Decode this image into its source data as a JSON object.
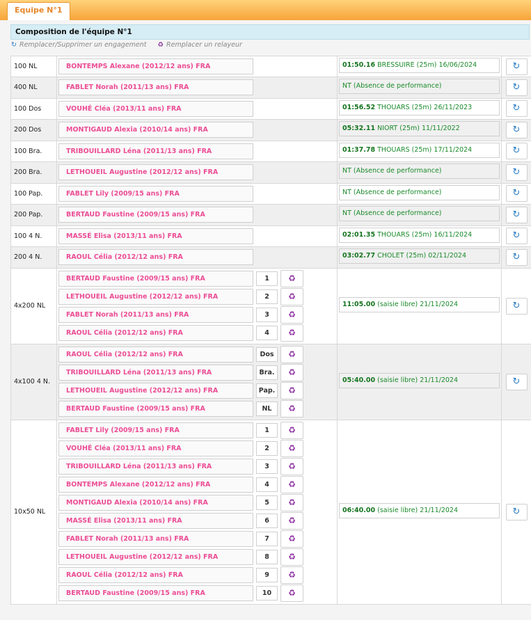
{
  "tab": {
    "label": "Equipe N°1"
  },
  "header": {
    "title": "Composition de l'équipe N°1"
  },
  "legend": {
    "replace_engagement": "Remplacer/Supprimer un engagement",
    "replace_relayer": "Remplacer un relayeur"
  },
  "icons": {
    "update": "refresh-icon",
    "relayer": "recycle-icon"
  },
  "colors": {
    "accent": "#f7a43a",
    "swimmer": "#ec4d95",
    "performance": "#1a8a2a",
    "update_icon": "#2b7cc3",
    "relayer_icon": "#8a2a9e"
  },
  "individual": [
    {
      "event": "100 NL",
      "swimmer": "BONTEMPS Alexane (2012/12 ans) FRA",
      "time": "01:50.16",
      "detail": "BRESSUIRE (25m) 16/06/2024"
    },
    {
      "event": "400 NL",
      "swimmer": "FABLET Norah (2011/13 ans) FRA",
      "time": "",
      "detail": "NT (Absence de performance)"
    },
    {
      "event": "100 Dos",
      "swimmer": "VOUHÉ Cléa (2013/11 ans) FRA",
      "time": "01:56.52",
      "detail": "THOUARS (25m) 26/11/2023"
    },
    {
      "event": "200 Dos",
      "swimmer": "MONTIGAUD Alexia (2010/14 ans) FRA",
      "time": "05:32.11",
      "detail": "NIORT (25m) 11/11/2022"
    },
    {
      "event": "100 Bra.",
      "swimmer": "TRIBOUILLARD Léna (2011/13 ans) FRA",
      "time": "01:37.78",
      "detail": "THOUARS (25m) 17/11/2024"
    },
    {
      "event": "200 Bra.",
      "swimmer": "LETHOUEIL Augustine (2012/12 ans) FRA",
      "time": "",
      "detail": "NT (Absence de performance)"
    },
    {
      "event": "100 Pap.",
      "swimmer": "FABLET Lily (2009/15 ans) FRA",
      "time": "",
      "detail": "NT (Absence de performance)"
    },
    {
      "event": "200 Pap.",
      "swimmer": "BERTAUD Faustine (2009/15 ans) FRA",
      "time": "",
      "detail": "NT (Absence de performance)"
    },
    {
      "event": "100 4 N.",
      "swimmer": "MASSÉ Elisa (2013/11 ans) FRA",
      "time": "02:01.35",
      "detail": "THOUARS (25m) 16/11/2024"
    },
    {
      "event": "200 4 N.",
      "swimmer": "RAOUL Célia (2012/12 ans) FRA",
      "time": "03:02.77",
      "detail": "CHOLET (25m) 02/11/2024"
    }
  ],
  "relays": [
    {
      "event": "4x200 NL",
      "time": "11:05.00",
      "detail": "(saisie libre) 21/11/2024",
      "legs": [
        {
          "pos": "1",
          "swimmer": "BERTAUD Faustine (2009/15 ans) FRA"
        },
        {
          "pos": "2",
          "swimmer": "LETHOUEIL Augustine (2012/12 ans) FRA"
        },
        {
          "pos": "3",
          "swimmer": "FABLET Norah (2011/13 ans) FRA"
        },
        {
          "pos": "4",
          "swimmer": "RAOUL Célia (2012/12 ans) FRA"
        }
      ]
    },
    {
      "event": "4x100 4 N.",
      "time": "05:40.00",
      "detail": "(saisie libre) 21/11/2024",
      "legs": [
        {
          "pos": "Dos",
          "swimmer": "RAOUL Célia (2012/12 ans) FRA"
        },
        {
          "pos": "Bra.",
          "swimmer": "TRIBOUILLARD Léna (2011/13 ans) FRA"
        },
        {
          "pos": "Pap.",
          "swimmer": "LETHOUEIL Augustine (2012/12 ans) FRA"
        },
        {
          "pos": "NL",
          "swimmer": "BERTAUD Faustine (2009/15 ans) FRA"
        }
      ]
    },
    {
      "event": "10x50 NL",
      "time": "06:40.00",
      "detail": "(saisie libre) 21/11/2024",
      "legs": [
        {
          "pos": "1",
          "swimmer": "FABLET Lily (2009/15 ans) FRA"
        },
        {
          "pos": "2",
          "swimmer": "VOUHÉ Cléa (2013/11 ans) FRA"
        },
        {
          "pos": "3",
          "swimmer": "TRIBOUILLARD Léna (2011/13 ans) FRA"
        },
        {
          "pos": "4",
          "swimmer": "BONTEMPS Alexane (2012/12 ans) FRA"
        },
        {
          "pos": "5",
          "swimmer": "MONTIGAUD Alexia (2010/14 ans) FRA"
        },
        {
          "pos": "6",
          "swimmer": "MASSÉ Elisa (2013/11 ans) FRA"
        },
        {
          "pos": "7",
          "swimmer": "FABLET Norah (2011/13 ans) FRA"
        },
        {
          "pos": "8",
          "swimmer": "LETHOUEIL Augustine (2012/12 ans) FRA"
        },
        {
          "pos": "9",
          "swimmer": "RAOUL Célia (2012/12 ans) FRA"
        },
        {
          "pos": "10",
          "swimmer": "BERTAUD Faustine (2009/15 ans) FRA"
        }
      ]
    }
  ]
}
